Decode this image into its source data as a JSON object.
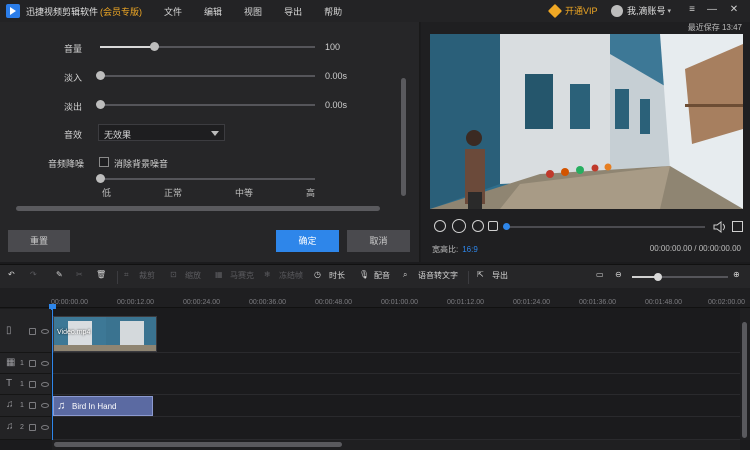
{
  "titlebar": {
    "app_title": "迅捷视频剪辑软件",
    "edition": "(会员专版)",
    "menu": [
      "文件",
      "编辑",
      "视图",
      "导出",
      "帮助"
    ],
    "vip_label": "开通VIP",
    "account_label": "我,滴账号"
  },
  "audio_props": {
    "volume": {
      "label": "音量",
      "value": "100",
      "level": 0.25
    },
    "fade_in": {
      "label": "淡入",
      "value": "0.00s",
      "level": 0
    },
    "fade_out": {
      "label": "淡出",
      "value": "0.00s",
      "level": 0
    },
    "effect": {
      "label": "音效",
      "selected": "无效果"
    },
    "denoise": {
      "label": "音频降噪",
      "checkbox_label": "消除背景噪音",
      "checked": false,
      "level_labels": [
        "低",
        "正常",
        "中等",
        "高"
      ],
      "level": 0
    }
  },
  "buttons": {
    "reset": "重置",
    "confirm": "确定",
    "cancel": "取消"
  },
  "preview": {
    "save_status": "最近保存 13:47",
    "aspect_label": "宽高比:",
    "aspect_value": "16:9",
    "timecode": "00:00:00.00 / 00:00:00.00",
    "progress": 0
  },
  "toolbar": {
    "tools": [
      {
        "name": "裁剪",
        "enabled": false
      },
      {
        "name": "缩放",
        "enabled": false
      },
      {
        "name": "马赛克",
        "enabled": false
      },
      {
        "name": "冻结帧",
        "enabled": false
      },
      {
        "name": "时长",
        "enabled": true
      },
      {
        "name": "配音",
        "enabled": true
      },
      {
        "name": "语音转文字",
        "enabled": true
      },
      {
        "name": "导出",
        "enabled": true
      }
    ],
    "zoom_level": 0.27
  },
  "ruler": {
    "ticks": [
      "00:00:00.00",
      "00:00:12.00",
      "00:00:24.00",
      "00:00:36.00",
      "00:00:48.00",
      "00:01:00.00",
      "00:01:12.00",
      "00:01:24.00",
      "00:01:36.00",
      "00:01:48.00",
      "00:02:00.00"
    ]
  },
  "tracks": {
    "video_clip_label": "Video.mp4",
    "audio_clip_label": "Bird In Hand",
    "track_numbers": [
      "1",
      "1",
      "1",
      "1",
      "2"
    ]
  }
}
